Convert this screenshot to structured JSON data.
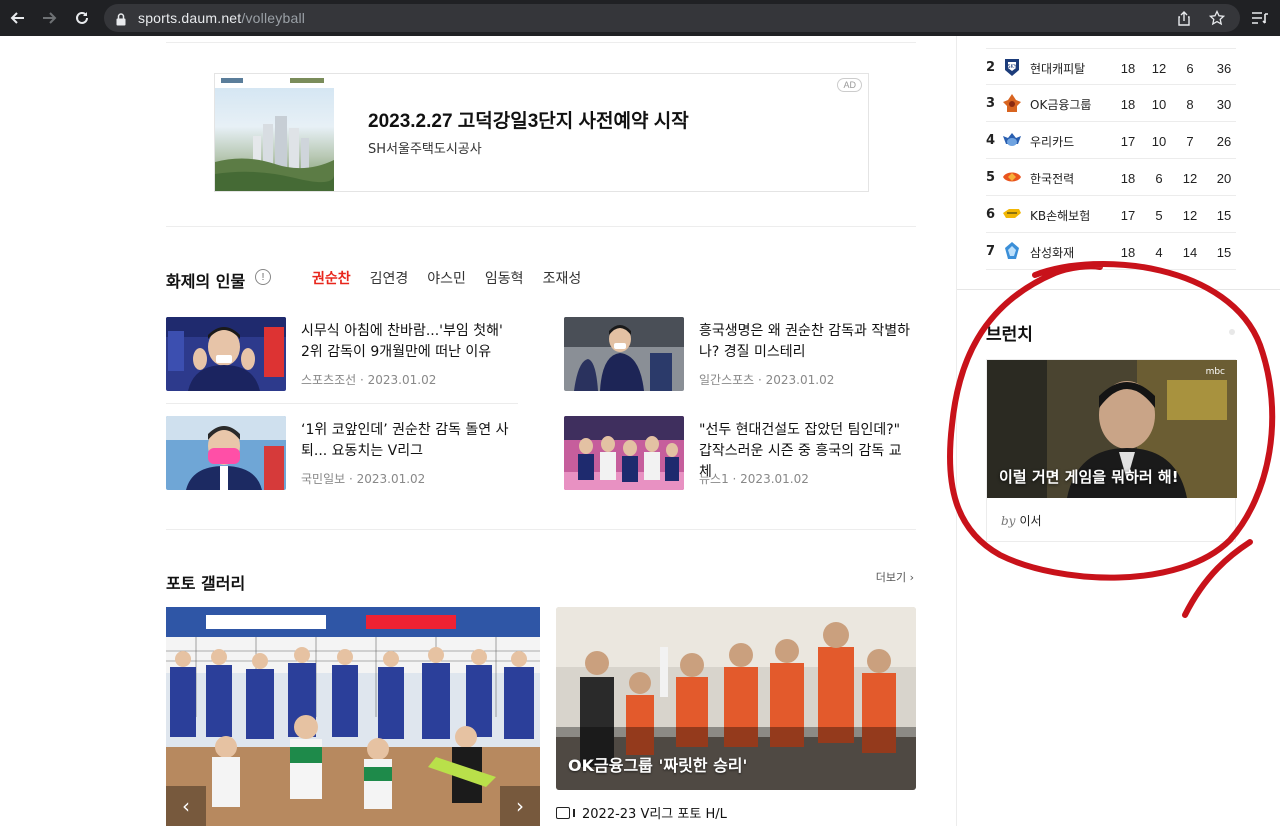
{
  "browser": {
    "url_host": "sports.daum.net",
    "url_path": "/volleyball"
  },
  "ad": {
    "badge": "AD",
    "title": "2023.2.27 고덕강일3단지 사전예약 시작",
    "sponsor": "SH서울주택도시공사"
  },
  "hot_people": {
    "title": "화제의 인물",
    "info_icon": "!",
    "tabs": [
      "권순찬",
      "김연경",
      "야스민",
      "임동혁",
      "조재성"
    ],
    "active_tab": 0,
    "news": [
      {
        "title": "시무식 아침에 찬바람...'부임 첫해' 2위 감독이 9개월만에 떠난 이유",
        "source": "스포츠조선 · 2023.01.02"
      },
      {
        "title": "흥국생명은 왜 권순찬 감독과 작별하나? 경질 미스테리",
        "source": "일간스포츠 · 2023.01.02"
      },
      {
        "title": "‘1위 코앞인데’ 권순찬 감독 돌연 사퇴... 요동치는 V리그",
        "source": "국민일보 · 2023.01.02"
      },
      {
        "title": "\"선두 현대건설도 잡았던 팀인데?\" 갑작스러운 시즌 중 흥국의 감독 교체",
        "source": "뉴스1 · 2023.01.02"
      }
    ]
  },
  "gallery": {
    "title": "포토 갤러리",
    "more": "더보기",
    "right_caption": "OK금융그룹 '짜릿한 승리'",
    "album_label": "2022-23 V리그 포토 H/L"
  },
  "standings": [
    {
      "rank": "2",
      "team": "현대캐피탈",
      "games": "18",
      "win": "12",
      "loss": "6",
      "points": "36"
    },
    {
      "rank": "3",
      "team": "OK금융그룹",
      "games": "18",
      "win": "10",
      "loss": "8",
      "points": "30"
    },
    {
      "rank": "4",
      "team": "우리카드",
      "games": "17",
      "win": "10",
      "loss": "7",
      "points": "26"
    },
    {
      "rank": "5",
      "team": "한국전력",
      "games": "18",
      "win": "6",
      "loss": "12",
      "points": "20"
    },
    {
      "rank": "6",
      "team": "KB손해보험",
      "games": "17",
      "win": "5",
      "loss": "12",
      "points": "15"
    },
    {
      "rank": "7",
      "team": "삼성화재",
      "games": "18",
      "win": "4",
      "loss": "14",
      "points": "15"
    }
  ],
  "brunch": {
    "title": "브런치",
    "caption": "이럴 거면 게임을 뭐하러 해!",
    "by": "by",
    "author": "이서"
  },
  "colors": {
    "accent_red": "#e8261c",
    "annotation_red": "#c8121a",
    "browser_bg": "#202124"
  }
}
